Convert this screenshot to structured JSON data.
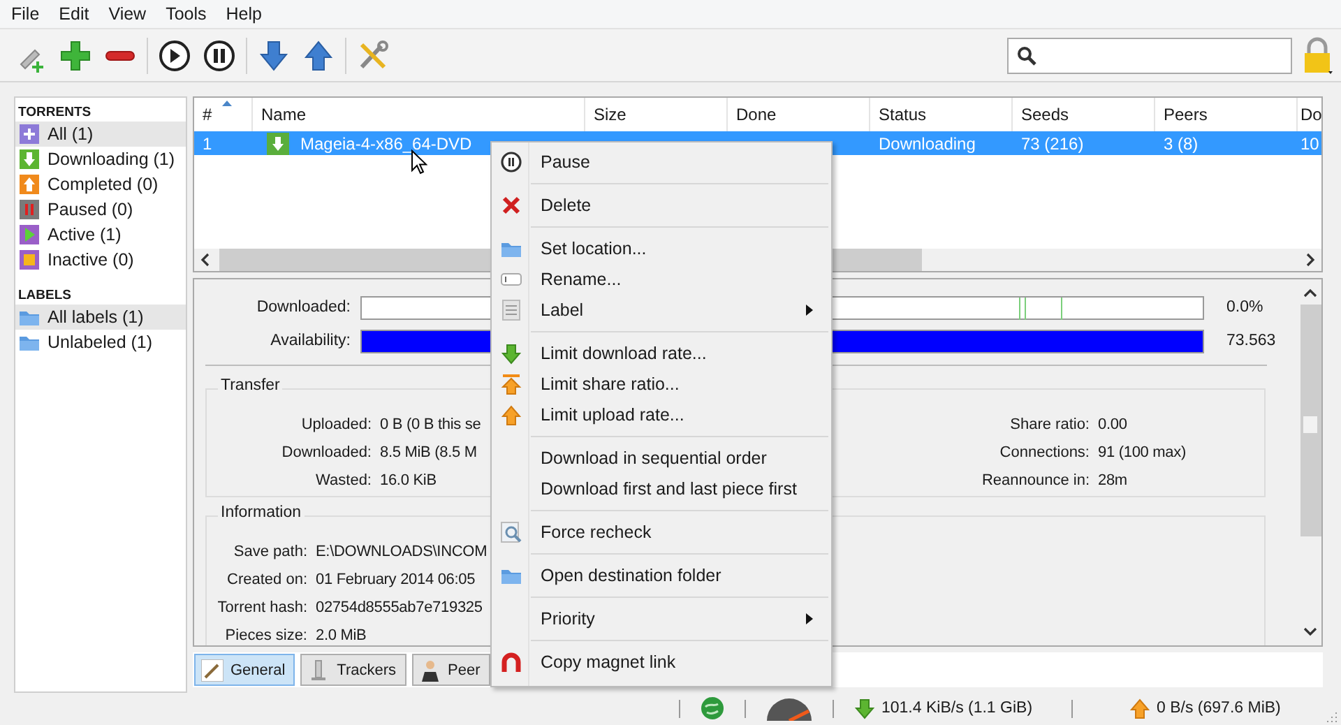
{
  "menu_bar": [
    "File",
    "Edit",
    "View",
    "Tools",
    "Help"
  ],
  "sidebar": {
    "sections": [
      {
        "title": "TORRENTS",
        "items": [
          {
            "label": "All (1)",
            "kind": "all",
            "selected": true
          },
          {
            "label": "Downloading (1)",
            "kind": "downloading",
            "selected": false
          },
          {
            "label": "Completed (0)",
            "kind": "completed",
            "selected": false
          },
          {
            "label": "Paused (0)",
            "kind": "paused",
            "selected": false
          },
          {
            "label": "Active (1)",
            "kind": "active",
            "selected": false
          },
          {
            "label": "Inactive (0)",
            "kind": "inactive",
            "selected": false
          }
        ]
      },
      {
        "title": "LABELS",
        "items": [
          {
            "label": "All labels (1)",
            "kind": "folder",
            "selected": true
          },
          {
            "label": "Unlabeled (1)",
            "kind": "folder",
            "selected": false
          }
        ]
      }
    ]
  },
  "table": {
    "columns": [
      "#",
      "Name",
      "Size",
      "Done",
      "Status",
      "Seeds",
      "Peers",
      "Do"
    ],
    "rows": [
      {
        "selected": true,
        "cells": [
          "1",
          "Mageia-4-x86_64-DVD",
          null,
          null,
          "Downloading",
          "73 (216)",
          "3 (8)",
          "10"
        ]
      }
    ]
  },
  "details": {
    "bars": [
      {
        "label": "Downloaded:",
        "level": 0,
        "reading": "0.0%"
      },
      {
        "label": "Availability:",
        "level": 1,
        "reading": "73.563"
      }
    ],
    "transfer": {
      "title": "Transfer",
      "left": [
        {
          "label": "Uploaded:",
          "value": "0 B (0 B this se"
        },
        {
          "label": "Downloaded:",
          "value": "8.5 MiB (8.5 M"
        },
        {
          "label": "Wasted:",
          "value": "16.0 KiB"
        }
      ],
      "right": [
        {
          "label": "Share ratio:",
          "value": "0.00"
        },
        {
          "label": "Connections:",
          "value": "91 (100 max)"
        },
        {
          "label": "Reannounce in:",
          "value": "28m"
        }
      ]
    },
    "information": {
      "title": "Information",
      "fields": [
        {
          "label": "Save path:",
          "value": "E:\\DOWNLOADS\\INCOM"
        },
        {
          "label": "Created on:",
          "value": "01 February 2014 06:05"
        },
        {
          "label": "Torrent hash:",
          "value": "02754d8555ab7e719325"
        },
        {
          "label": "Pieces size:",
          "value": "2.0 MiB"
        }
      ]
    }
  },
  "tabs": [
    {
      "label": "General",
      "kind": "general",
      "selected": true
    },
    {
      "label": "Trackers",
      "kind": "trackers",
      "selected": false
    },
    {
      "label": "Peer",
      "kind": "peers",
      "selected": false
    }
  ],
  "context_menu": {
    "groups": [
      [
        {
          "label": "Pause",
          "kind": "pause",
          "submenu": false
        }
      ],
      [
        {
          "label": "Delete",
          "kind": "delete",
          "submenu": false
        }
      ],
      [
        {
          "label": "Set location...",
          "kind": "folder",
          "submenu": false
        },
        {
          "label": "Rename...",
          "kind": "rename",
          "submenu": false
        },
        {
          "label": "Label",
          "kind": "label",
          "submenu": true
        }
      ],
      [
        {
          "label": "Limit download rate...",
          "kind": "download",
          "submenu": false
        },
        {
          "label": "Limit share ratio...",
          "kind": "ratio",
          "submenu": false
        },
        {
          "label": "Limit upload rate...",
          "kind": "upload",
          "submenu": false
        }
      ],
      [
        {
          "label": "Download in sequential order",
          "kind": "none",
          "submenu": false
        },
        {
          "label": "Download first and last piece first",
          "kind": "none",
          "submenu": false
        }
      ],
      [
        {
          "label": "Force recheck",
          "kind": "recheck",
          "submenu": false
        }
      ],
      [
        {
          "label": "Open destination folder",
          "kind": "folder",
          "submenu": false
        }
      ],
      [
        {
          "label": "Priority",
          "kind": "none",
          "submenu": true
        }
      ],
      [
        {
          "label": "Copy magnet link",
          "kind": "magnet",
          "submenu": false
        }
      ]
    ]
  },
  "status_bar": {
    "download": "101.4 KiB/s (1.1 GiB)",
    "upload": "0 B/s (697.6 MiB)"
  }
}
